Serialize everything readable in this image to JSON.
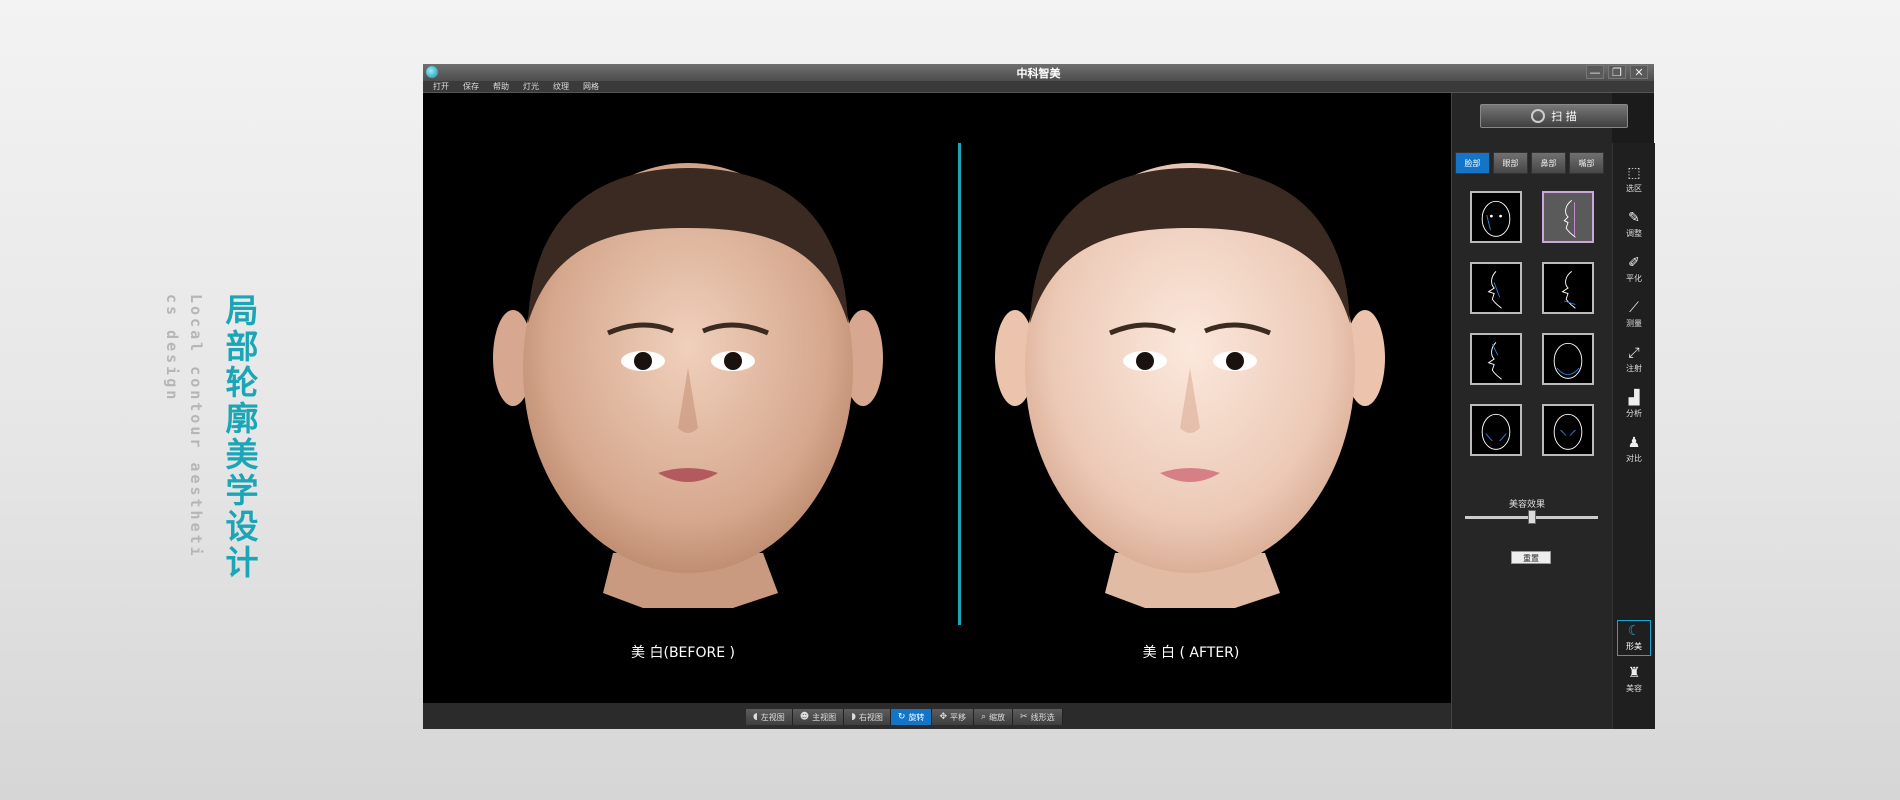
{
  "side": {
    "title_chars": [
      "局",
      "部",
      "轮",
      "廓",
      "美",
      "学",
      "设",
      "计"
    ],
    "subtitle1": "Local contour aestheti",
    "subtitle2": "cs design"
  },
  "window": {
    "title": "中科智美",
    "controls": {
      "minimize": "—",
      "restore": "❐",
      "close": "✕"
    },
    "menu": [
      "打开",
      "保存",
      "帮助",
      "灯光",
      "纹理",
      "网格"
    ]
  },
  "viewport": {
    "left_caption": "美 白(BEFORE )",
    "right_caption": "美 白 ( AFTER)",
    "accent_color": "#1aa6b6"
  },
  "bottom_toolbar": [
    {
      "label": "左视图",
      "icon": "head-left-icon",
      "active": false
    },
    {
      "label": "主视图",
      "icon": "person-icon",
      "active": false
    },
    {
      "label": "右视图",
      "icon": "head-right-icon",
      "active": false
    },
    {
      "label": "旋转",
      "icon": "rotate-icon",
      "active": true
    },
    {
      "label": "平移",
      "icon": "move-icon",
      "active": false
    },
    {
      "label": "缩放",
      "icon": "zoom-icon",
      "active": false
    },
    {
      "label": "线形选",
      "icon": "lasso-icon",
      "active": false
    }
  ],
  "panel": {
    "scan_label": "扫 描",
    "tabs": [
      {
        "label": "脸部",
        "active": true
      },
      {
        "label": "眼部",
        "active": false
      },
      {
        "label": "鼻部",
        "active": false
      },
      {
        "label": "嘴部",
        "active": false
      }
    ],
    "beauty_label": "美容效果",
    "beauty_level": 0.5,
    "reset_label": "重置"
  },
  "right_tools": [
    {
      "label": "选区",
      "icon": "select-icon",
      "active": false
    },
    {
      "label": "调整",
      "icon": "pencil-icon",
      "active": false
    },
    {
      "label": "平化",
      "icon": "brush-icon",
      "active": false
    },
    {
      "label": "测量",
      "icon": "ruler-icon",
      "active": false
    },
    {
      "label": "注射",
      "icon": "syringe-icon",
      "active": false
    },
    {
      "label": "分析",
      "icon": "chart-icon",
      "active": false
    },
    {
      "label": "对比",
      "icon": "compare-icon",
      "active": false
    },
    {
      "label": "形美",
      "icon": "moon-icon",
      "active": true
    },
    {
      "label": "美容",
      "icon": "stamp-icon",
      "active": false
    }
  ]
}
